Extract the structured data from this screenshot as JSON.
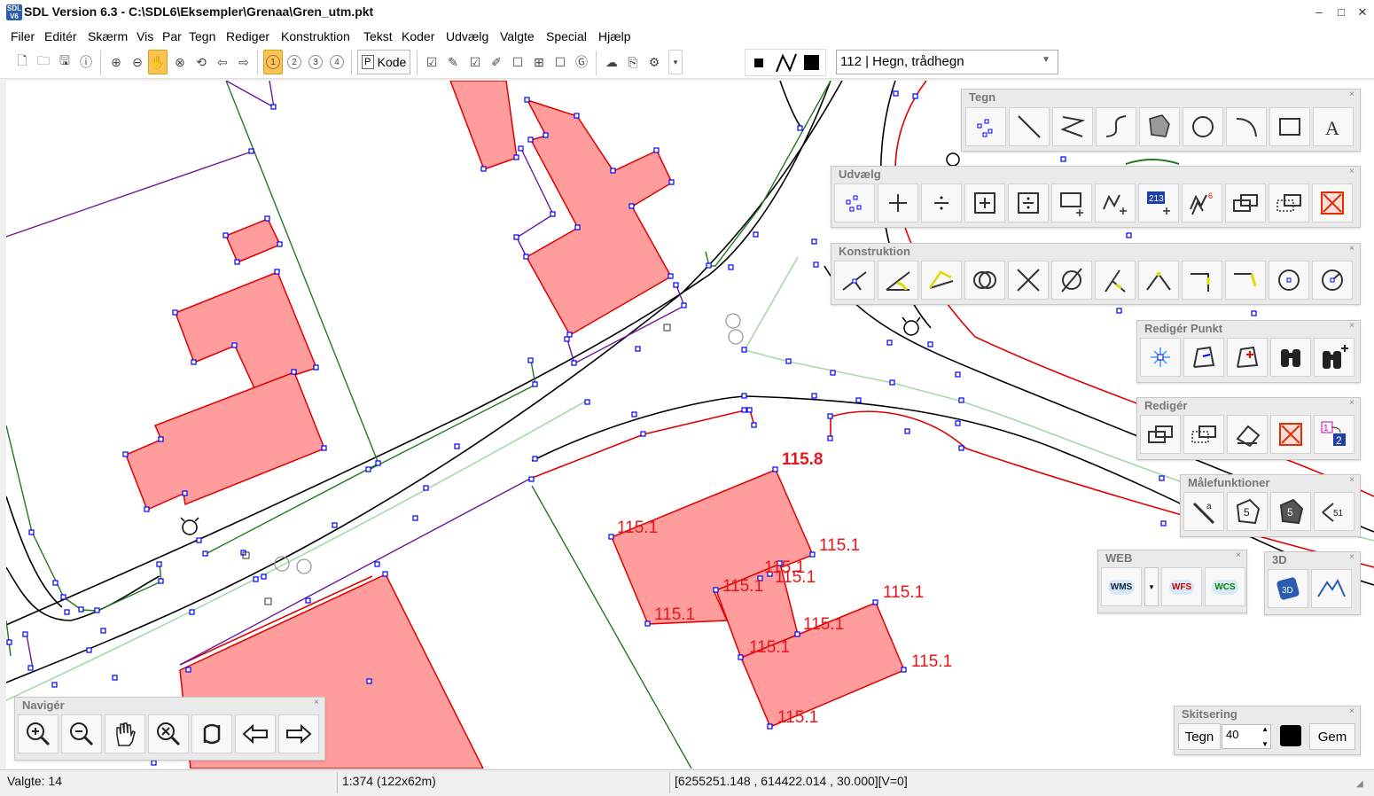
{
  "window": {
    "title": "SDL Version 6.3 - C:\\SDL6\\Eksempler\\Grenaa\\Gren_utm.pkt",
    "icon_text": "SDL V6",
    "minimize": "–",
    "restore": "□",
    "close": "✕"
  },
  "menu": [
    "Filer",
    "Editér",
    "Skærm",
    "Vis",
    "Par",
    "Tegn",
    "Rediger",
    "Konstruktion",
    "Tekst",
    "Koder",
    "Udvælg",
    "Valgte",
    "Special",
    "Hjælp"
  ],
  "toolbar": {
    "kode_label": "Kode",
    "kode_prefix": "P",
    "layer_buttons": [
      "1",
      "2",
      "3",
      "4"
    ],
    "code_select": "112 | Hegn, trådhegn"
  },
  "map": {
    "labels": [
      "115.8",
      "115.1",
      "115.1",
      "115.1",
      "115.1",
      "115.1",
      "115.1",
      "115.1",
      "115.1",
      "115.1",
      "115.1",
      "115.1"
    ]
  },
  "panels": {
    "tegn": {
      "title": "Tegn",
      "close": "×"
    },
    "udvaelg": {
      "title": "Udvælg",
      "close": "×"
    },
    "konstruktion": {
      "title": "Konstruktion",
      "close": "×"
    },
    "rediger_punkt": {
      "title": "Redigér Punkt",
      "close": "×"
    },
    "rediger": {
      "title": "Redigér",
      "close": "×"
    },
    "maalefunktioner": {
      "title": "Målefunktioner",
      "close": "×"
    },
    "web": {
      "title": "WEB",
      "close": "×",
      "buttons": [
        "WMS",
        "WFS",
        "WCS"
      ]
    },
    "three_d": {
      "title": "3D",
      "close": "×"
    },
    "navigator": {
      "title": "Navigér",
      "close": "×"
    },
    "skitsering": {
      "title": "Skitsering",
      "close": "×",
      "tegn_label": "Tegn",
      "size_value": "40",
      "gem_label": "Gem"
    }
  },
  "status": {
    "selected": "Valgte: 14",
    "scale": "1:374 (122x62m)",
    "coords": "[6255251.148 , 614422.014 , 30.000][V=0]"
  },
  "colors": {
    "building_fill": "#ff9c9c",
    "building_stroke": "#e00000",
    "road": "#000000",
    "hedge": "#1f7a1f",
    "path": "#a8d8a8",
    "fence": "#6a1a9a",
    "vertex": "#0000ff",
    "active_tool": "#f9c44f"
  }
}
